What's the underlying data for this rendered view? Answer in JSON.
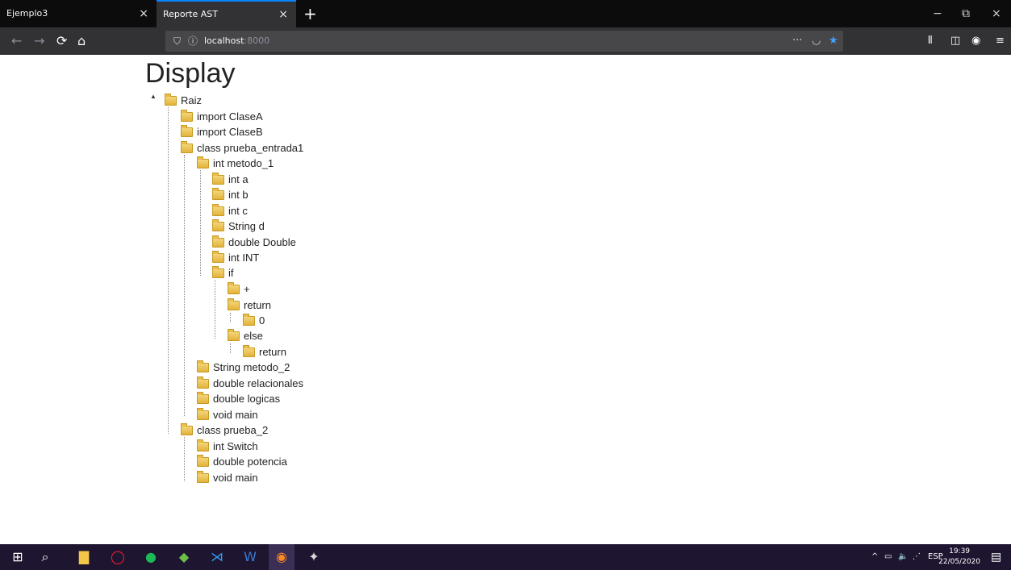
{
  "browser": {
    "tabs": [
      {
        "label": "Ejemplo3",
        "close": "×"
      },
      {
        "label": "Reporte AST",
        "close": "×"
      }
    ],
    "new_tab": "+",
    "window_controls": {
      "minimize": "−",
      "restore": "⧉",
      "close": "×"
    },
    "nav": {
      "back": "←",
      "forward": "→",
      "reload": "⟳",
      "home": "⌂"
    },
    "url": {
      "host": "localhost",
      "port": ":8000"
    },
    "url_actions": {
      "more": "···",
      "pocket": "◡",
      "bookmark": "★"
    },
    "toolbar_right": {
      "library": "⫴",
      "sidebar": "◫",
      "account": "◉",
      "menu": "≡"
    }
  },
  "page": {
    "heading": "Display",
    "tree_nodes": [
      "Raiz",
      "import ClaseA",
      "import ClaseB",
      "class prueba_entrada1",
      "int metodo_1",
      "int a",
      "int b",
      "int c",
      "String d",
      "double Double",
      "int INT",
      "if",
      "+",
      "return",
      "0",
      "else",
      "return",
      "String metodo_2",
      "double relacionales",
      "double logicas",
      "void main",
      "class prueba_2",
      "int Switch",
      "double potencia",
      "void main"
    ]
  },
  "taskbar": {
    "icons": [
      {
        "name": "windows-start-icon",
        "glyph": "⊞",
        "color": "#ffffff"
      },
      {
        "name": "search-icon",
        "glyph": "⌕",
        "color": "#ffffff"
      },
      {
        "name": "file-explorer-icon",
        "glyph": "▇",
        "color": "#f3c64a"
      },
      {
        "name": "opera-icon",
        "glyph": "◯",
        "color": "#ff1b2d"
      },
      {
        "name": "spotify-icon",
        "glyph": "●",
        "color": "#1db954"
      },
      {
        "name": "app-icon",
        "glyph": "◆",
        "color": "#6cc04a"
      },
      {
        "name": "vscode-icon",
        "glyph": "⋊",
        "color": "#2f9ef0"
      },
      {
        "name": "word-icon",
        "glyph": "W",
        "color": "#3b7bd6"
      },
      {
        "name": "firefox-icon",
        "glyph": "◉",
        "color": "#ff8a24"
      },
      {
        "name": "app-icon-2",
        "glyph": "✦",
        "color": "#d9d9d9"
      }
    ],
    "tray": {
      "chevron": "^",
      "network": "▭",
      "volume": "🔈",
      "wifi": "⋰",
      "language": "ESP"
    },
    "clock": {
      "time": "19:39",
      "date": "22/05/2020"
    },
    "notifications": "▤"
  }
}
